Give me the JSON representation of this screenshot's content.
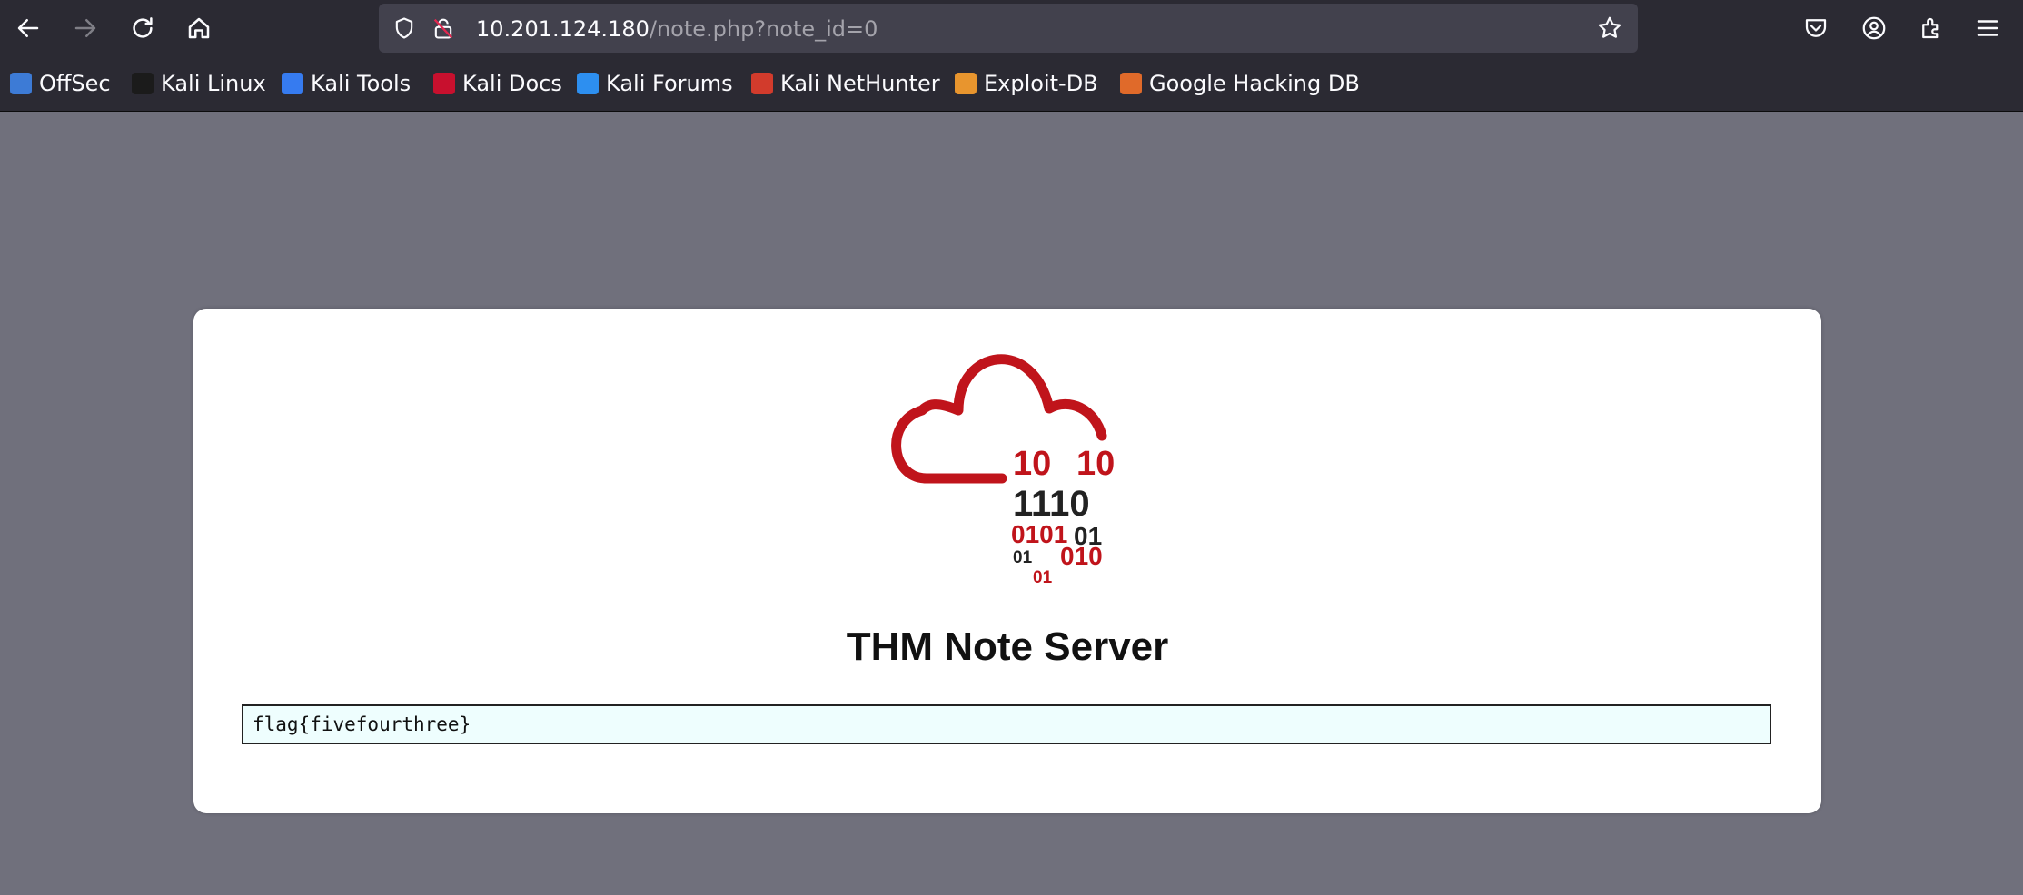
{
  "toolbar": {
    "back_icon": "back-arrow-icon",
    "forward_icon": "forward-arrow-icon",
    "reload_icon": "reload-icon",
    "home_icon": "home-icon"
  },
  "urlbar": {
    "host": "10.201.124.180",
    "path": "/note.php?note_id=0",
    "icons": [
      "shield-icon",
      "insecure-lock-icon",
      "bookmark-star-icon"
    ]
  },
  "toolbar_right_icons": [
    "pocket-icon",
    "account-icon",
    "extensions-icon",
    "menu-icon"
  ],
  "bookmarks": [
    {
      "label": "OffSec",
      "color": "#3d7bd6"
    },
    {
      "label": "Kali Linux",
      "color": "#1b1b1b"
    },
    {
      "label": "Kali Tools",
      "color": "#367bf0"
    },
    {
      "label": "Kali Docs",
      "color": "#c8102e"
    },
    {
      "label": "Kali Forums",
      "color": "#2d8ff0"
    },
    {
      "label": "Kali NetHunter",
      "color": "#d23b2c"
    },
    {
      "label": "Exploit-DB",
      "color": "#e8952e"
    },
    {
      "label": "Google Hacking DB",
      "color": "#e06a2a"
    }
  ],
  "page": {
    "logo": {
      "row1": [
        "10",
        "10"
      ],
      "row2": "1110",
      "row3": [
        "0101",
        "01"
      ],
      "row4": [
        "01",
        "010"
      ],
      "row5": "01",
      "accent": "#c0141b",
      "dark": "#222222"
    },
    "title": "THM Note Server",
    "note": "flag{fivefourthree}"
  },
  "colors": {
    "page_background": "#70707c",
    "card_background": "#ffffff",
    "note_background": "#eefefe"
  }
}
